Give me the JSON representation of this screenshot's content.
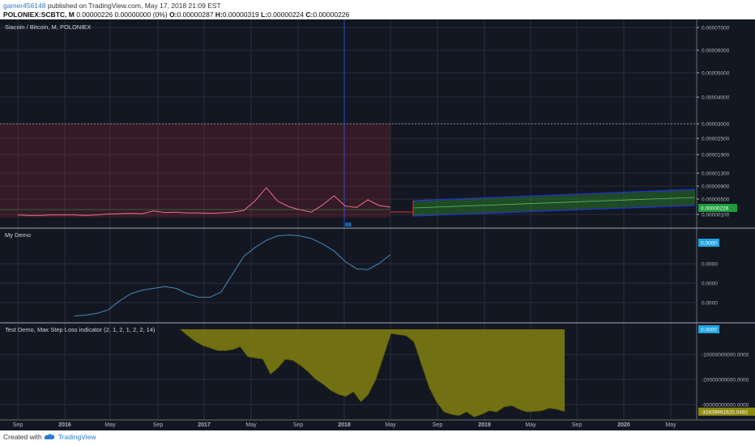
{
  "header": {
    "user": "gamer456148",
    "published_text": " published on TradingView.com, May 17, 2018 21:09 EST",
    "symbol": "POLONIEX:SCBTC, M",
    "quote_text": " 0.00000226 0.00000000 (0%) ",
    "o_label": "O:",
    "o_value": "0.00000287",
    "h_label": " H:",
    "h_value": "0.00000319",
    "l_label": " L:",
    "l_value": "0.00000224",
    "c_label": " C:",
    "c_value": "0.00000226"
  },
  "footer": {
    "created_with": "Created with",
    "brand": "TradingView"
  },
  "colors": {
    "background": "#131722",
    "grid": "#2a2e39",
    "price_line": "#f06e8a",
    "rsi_line": "#4a86b4",
    "area_fill": "#7a7a14",
    "channel_green": "#2d8a2d",
    "channel_blue": "#2030d8",
    "last_price_bg": "#1f9d3c",
    "zero_label_bg": "#1fa3e0",
    "step_loss_label_bg": "#8b8b0f"
  },
  "chart_data": [
    {
      "type": "line",
      "title": "Siacoin / Bitcoin, M, POLONIEX",
      "x_ticks": [
        "Sep",
        "2016",
        "May",
        "Sep",
        "2017",
        "May",
        "Sep",
        "2018",
        "May",
        "Sep",
        "2019",
        "May",
        "Sep",
        "2020",
        "May"
      ],
      "y_ticks": [
        "0.00007000",
        "0.00006000",
        "0.00005000",
        "0.00004000",
        "0.00003000",
        "0.00002500",
        "0.00001900",
        "0.00001300",
        "0.00000900",
        "0.00000500",
        "0.00000100"
      ],
      "last_price_label": "0.00000226",
      "bar_marker": "88",
      "series": [
        {
          "values": [
            9e-07,
            8e-07,
            8e-07,
            9e-07,
            9e-07,
            9e-07,
            8e-07,
            9e-07,
            1.1e-06,
            1.2e-06,
            1.3e-06,
            1.2e-06,
            1.9e-06,
            1.5e-06,
            1.6e-06,
            1.4e-06,
            1.4e-06,
            1.3e-06,
            1.4e-06,
            1.6e-06,
            2e-06,
            4.5e-06,
            8.5e-06,
            4.5e-06,
            3e-06,
            2.2e-06,
            1.6e-06,
            3.5e-06,
            6e-06,
            3.2e-06,
            2.8e-06,
            4.8e-06,
            3.3e-06,
            2.9e-06
          ]
        }
      ]
    },
    {
      "type": "line",
      "title": "My Demo",
      "y_ticks": [
        "0.0000",
        "0.0000",
        "0.0000",
        "0.0000"
      ],
      "zero_label": "0.0000",
      "series": [
        {
          "values": [
            0.05,
            0.06,
            0.08,
            0.12,
            0.22,
            0.3,
            0.34,
            0.36,
            0.38,
            0.36,
            0.3,
            0.26,
            0.26,
            0.32,
            0.52,
            0.72,
            0.82,
            0.9,
            0.95,
            0.96,
            0.95,
            0.92,
            0.86,
            0.78,
            0.66,
            0.58,
            0.57,
            0.64,
            0.74
          ]
        }
      ]
    },
    {
      "type": "area",
      "title": "Test Demo, Max Step Loss indicator (2, 1, 2, 1, 2, 2, 14)",
      "y_ticks": [
        "0.0000",
        "-10000000000.0000",
        "-20000000000.0000",
        "-30000000000.0000"
      ],
      "zero_label": "0.0000",
      "current_label": "-32839991620.0492",
      "series": [
        {
          "values": [
            0,
            -2500000000,
            -4800000000,
            -6500000000,
            -7500000000,
            -8500000000,
            -8600000000,
            -8200000000,
            -7000000000,
            -11000000000,
            -11500000000,
            -12000000000,
            -18000000000,
            -15500000000,
            -12000000000,
            -12500000000,
            -14500000000,
            -17000000000,
            -20000000000,
            -22000000000,
            -24500000000,
            -26000000000,
            -26800000000,
            -25000000000,
            -29000000000,
            -26000000000,
            -20000000000,
            -11000000000,
            -1800000000,
            -2200000000,
            -2600000000,
            -5000000000,
            -14000000000,
            -23000000000,
            -29000000000,
            -33000000000,
            -34000000000,
            -34500000000,
            -33000000000,
            -35000000000,
            -34000000000,
            -32500000000,
            -33000000000,
            -31000000000,
            -30500000000,
            -32000000000,
            -33000000000,
            -32800000000,
            -32500000000,
            -31500000000,
            -32000000000,
            -32840000000
          ]
        }
      ]
    }
  ]
}
